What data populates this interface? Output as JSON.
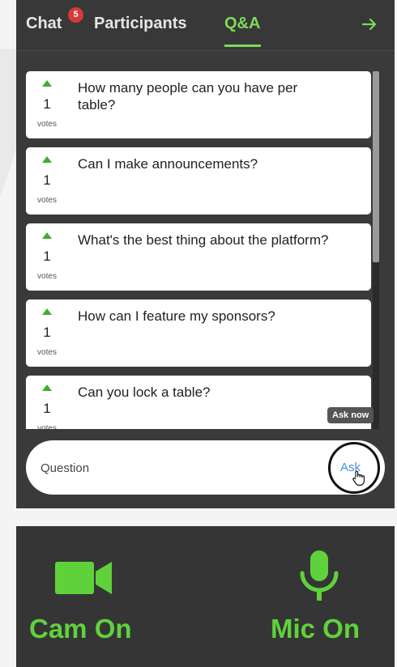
{
  "tabs": {
    "chat_label": "Chat",
    "chat_badge": "5",
    "participants_label": "Participants",
    "qa_label": "Q&A",
    "active": "Q&A"
  },
  "questions": [
    {
      "text": "How many people can you have per table?",
      "votes": "1",
      "votes_label": "votes"
    },
    {
      "text": "Can I make announcements?",
      "votes": "1",
      "votes_label": "votes"
    },
    {
      "text": "What's the best thing about the platform?",
      "votes": "1",
      "votes_label": "votes"
    },
    {
      "text": "How can I feature my sponsors?",
      "votes": "1",
      "votes_label": "votes"
    },
    {
      "text": "Can you lock a table?",
      "votes": "1",
      "votes_label": "votes"
    }
  ],
  "tooltip": "Ask now",
  "ask": {
    "placeholder": "Question",
    "button_label": "Ask"
  },
  "controls": {
    "cam_label": "Cam On",
    "mic_label": "Mic On"
  },
  "icons": {
    "collapse": "arrow-right-icon",
    "upvote": "upvote-caret-icon",
    "cursor": "hand-cursor-icon",
    "camera": "video-camera-icon",
    "microphone": "microphone-icon"
  },
  "colors": {
    "accent_green": "#7ed957",
    "control_green": "#5fd23b",
    "badge_red": "#d83a3a",
    "ask_blue": "#4a90e2",
    "panel_bg": "#3a3a3a"
  }
}
